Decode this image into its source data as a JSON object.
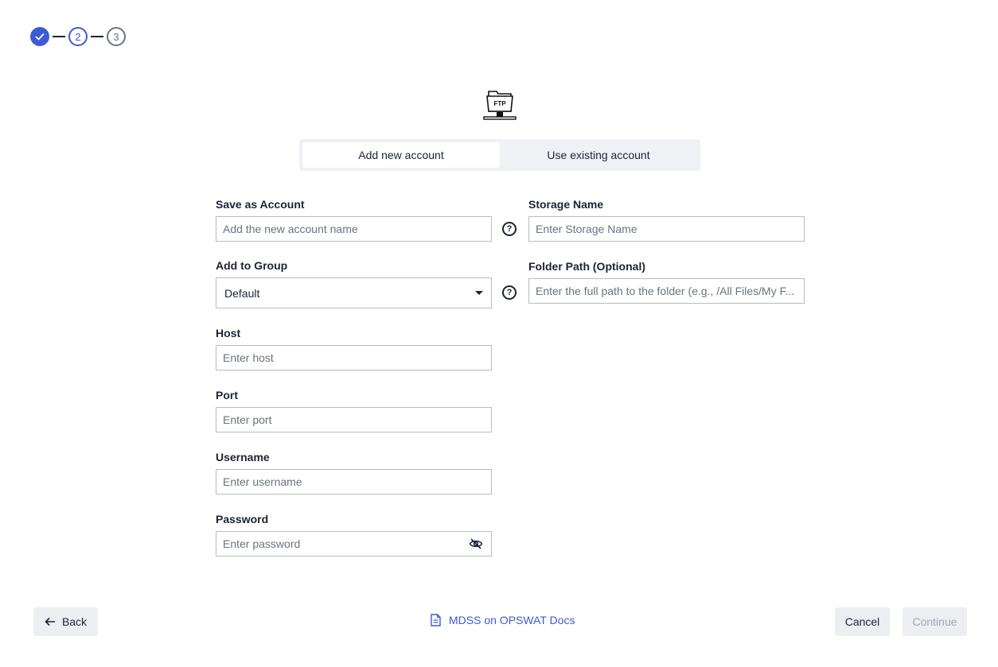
{
  "stepper": {
    "steps": [
      {
        "state": "done",
        "label": ""
      },
      {
        "state": "current",
        "label": "2"
      },
      {
        "state": "pending",
        "label": "3"
      }
    ]
  },
  "logo": {
    "text": "FTP",
    "icon": "ftp-folder-icon"
  },
  "tabs": [
    {
      "label": "Add new account",
      "active": true
    },
    {
      "label": "Use existing account",
      "active": false
    }
  ],
  "form": {
    "account_name": {
      "label": "Save as Account",
      "placeholder": "Add the new account name",
      "value": ""
    },
    "group": {
      "label": "Add to Group",
      "value": "Default"
    },
    "host": {
      "label": "Host",
      "placeholder": "Enter host",
      "value": ""
    },
    "port": {
      "label": "Port",
      "placeholder": "Enter port",
      "value": ""
    },
    "username": {
      "label": "Username",
      "placeholder": "Enter username",
      "value": ""
    },
    "password": {
      "label": "Password",
      "placeholder": "Enter password",
      "value": ""
    },
    "storage_name": {
      "label": "Storage Name",
      "placeholder": "Enter Storage Name",
      "value": ""
    },
    "folder_path": {
      "label": "Folder Path (Optional)",
      "placeholder": "Enter the full path to the folder (e.g., /All Files/My F...",
      "value": ""
    }
  },
  "footer": {
    "back_label": "Back",
    "docs_label": "MDSS on OPSWAT Docs",
    "cancel_label": "Cancel",
    "continue_label": "Continue"
  },
  "colors": {
    "accent": "#3d5ad6",
    "text": "#1d2333",
    "button_bg": "#eceef2",
    "disabled_text": "#a2a6b0"
  }
}
